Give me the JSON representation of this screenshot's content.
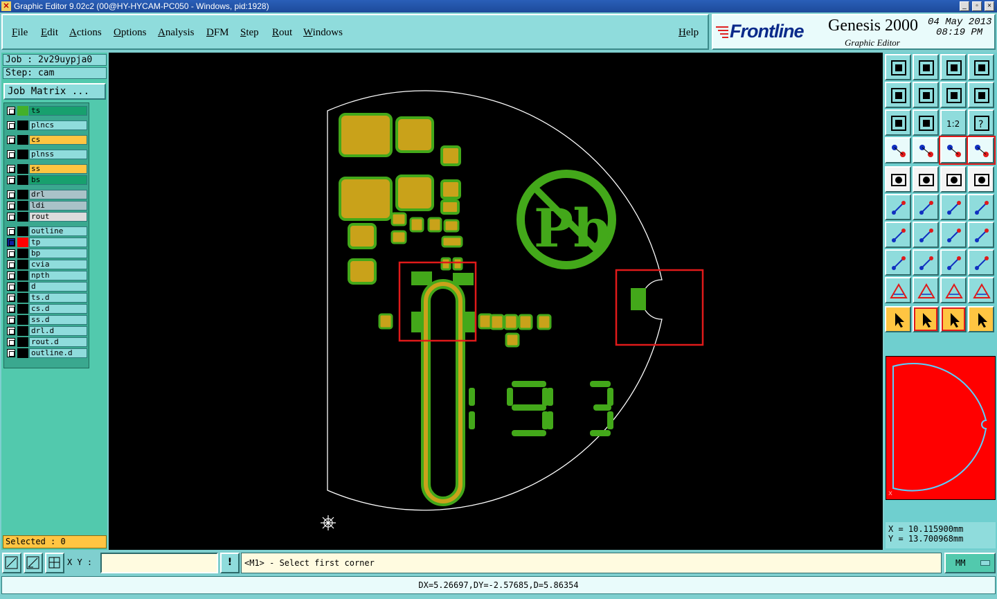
{
  "window": {
    "title": "Graphic Editor 9.02c2 (00@HY-HYCAM-PC050 - Windows, pid:1928)",
    "controls": [
      "_",
      "▫",
      "×"
    ]
  },
  "menu": {
    "items": [
      "File",
      "Edit",
      "Actions",
      "Options",
      "Analysis",
      "DFM",
      "Step",
      "Rout",
      "Windows"
    ],
    "help": "Help"
  },
  "logo": {
    "brand": "Frontline",
    "product": "Genesis 2000",
    "subtitle": "Graphic Editor",
    "date": "04 May 2013",
    "time": "08:19 PM"
  },
  "job": {
    "job_label": "Job : 2v29uypja0",
    "step_label": "Step: cam",
    "matrix_button": "Job Matrix ..."
  },
  "layers": [
    {
      "name": "ts",
      "color": "#18a06e",
      "swatch": "#43b02a"
    },
    {
      "name": "plncs",
      "color": "#8fdcdc",
      "swatch": "#000000"
    },
    {
      "name": "cs",
      "color": "#ffc542",
      "swatch": "#000000"
    },
    {
      "name": "plnss",
      "color": "#8fdcdc",
      "swatch": "#000000"
    },
    {
      "name": "ss",
      "color": "#ffc542",
      "swatch": "#000000"
    },
    {
      "name": "bs",
      "color": "#18a06e",
      "swatch": "#000000"
    },
    {
      "name": "drl",
      "color": "#a9c2c8",
      "swatch": "#000000"
    },
    {
      "name": "ldi",
      "color": "#a9c2c8",
      "swatch": "#000000"
    },
    {
      "name": "rout",
      "color": "#dcdcdc",
      "swatch": "#000000"
    },
    {
      "name": "outline",
      "color": "#8fdcdc",
      "swatch": "#000000"
    },
    {
      "name": "tp",
      "color": "#8fdcdc",
      "swatch": "#ff0000"
    },
    {
      "name": "bp",
      "color": "#8fdcdc",
      "swatch": "#000000"
    },
    {
      "name": "cvia",
      "color": "#8fdcdc",
      "swatch": "#000000"
    },
    {
      "name": "npth",
      "color": "#8fdcdc",
      "swatch": "#000000"
    },
    {
      "name": "d",
      "color": "#8fdcdc",
      "swatch": "#000000"
    },
    {
      "name": "ts.d",
      "color": "#8fdcdc",
      "swatch": "#000000"
    },
    {
      "name": "cs.d",
      "color": "#8fdcdc",
      "swatch": "#000000"
    },
    {
      "name": "ss.d",
      "color": "#8fdcdc",
      "swatch": "#000000"
    },
    {
      "name": "drl.d",
      "color": "#8fdcdc",
      "swatch": "#000000"
    },
    {
      "name": "rout.d",
      "color": "#8fdcdc",
      "swatch": "#000000"
    },
    {
      "name": "outline.d",
      "color": "#8fdcdc",
      "swatch": "#000000"
    }
  ],
  "selected_label": "Selected : 0",
  "canvas": {
    "pb_text": "Pb",
    "silkscreen_digits": [
      "1",
      "9",
      "1",
      "3"
    ]
  },
  "coords": {
    "x": "X = 10.115900mm",
    "y": "Y = 13.700968mm"
  },
  "bottom": {
    "xy_label": "X Y :",
    "xy_value": "",
    "bang": "!",
    "prompt": "<M1> - Select first corner",
    "units": "MM"
  },
  "status": "DX=5.26697,DY=-2.57685,D=5.86354",
  "colors": {
    "copper": "#43a81a",
    "pad_fill": "#c9a21a",
    "selection": "#e01a1a",
    "outline": "#ffffff"
  }
}
